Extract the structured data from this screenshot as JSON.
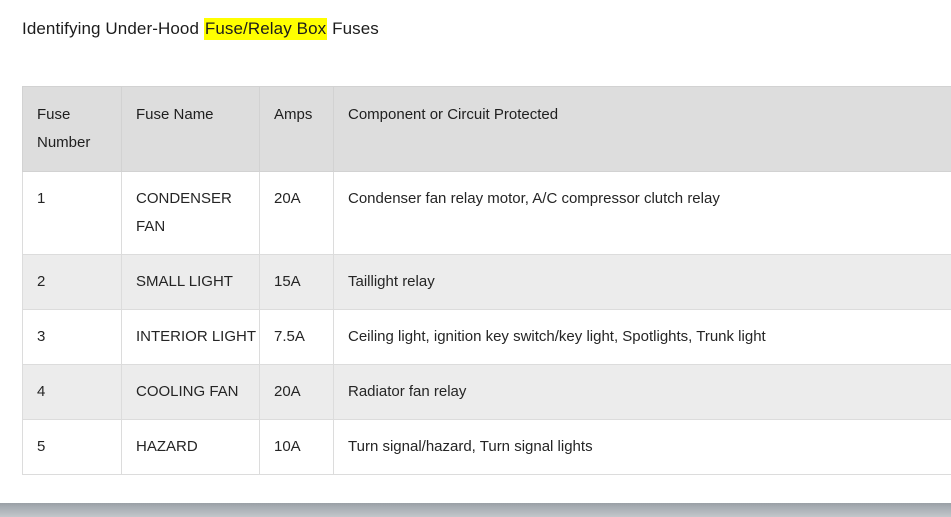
{
  "document": {
    "title_before": "Identifying Under-Hood ",
    "title_highlight": "Fuse/Relay Box",
    "title_after": " Fuses",
    "highlight_color": "#ffff00"
  },
  "table": {
    "headers": {
      "fuse_number": "Fuse Number",
      "fuse_name": "Fuse Name",
      "amps": "Amps",
      "component": "Component or Circuit Protected"
    },
    "rows": [
      {
        "number": "1",
        "name": "CONDENSER FAN",
        "amps": "20A",
        "component": "Condenser fan relay motor, A/C compressor clutch relay"
      },
      {
        "number": "2",
        "name": "SMALL LIGHT",
        "amps": "15A",
        "component": "Taillight relay"
      },
      {
        "number": "3",
        "name": "INTERIOR LIGHT",
        "amps": "7.5A",
        "component": "Ceiling light, ignition key switch/key light, Spotlights, Trunk light"
      },
      {
        "number": "4",
        "name": "COOLING FAN",
        "amps": "20A",
        "component": "Radiator fan relay"
      },
      {
        "number": "5",
        "name": "HAZARD",
        "amps": "10A",
        "component": "Turn signal/hazard, Turn signal lights"
      }
    ]
  },
  "colors": {
    "header_background": "#dddddd",
    "alt_row_background": "#ececec",
    "border": "#dcdcdc",
    "text": "#252525"
  }
}
